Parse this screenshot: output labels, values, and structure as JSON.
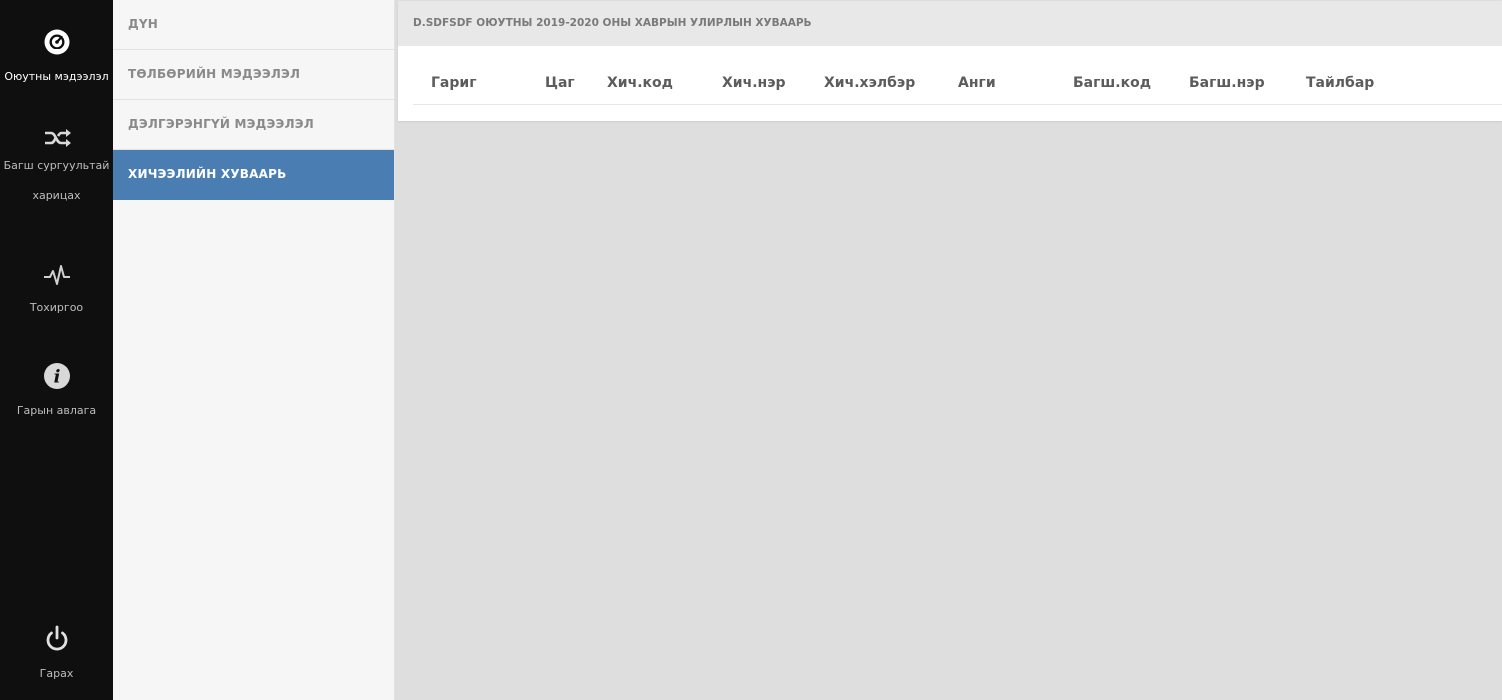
{
  "rail": {
    "items": [
      {
        "label": "Оюутны мэдээлэл",
        "icon": "dashboard-icon",
        "active": true
      },
      {
        "label": "Багш сургуультай",
        "label2": "харицах",
        "icon": "shuffle-icon"
      },
      {
        "label": "Тохиргоо",
        "icon": "pulse-icon"
      },
      {
        "label": "Гарын авлага",
        "icon": "info-icon"
      },
      {
        "label": "Гарах",
        "icon": "power-icon"
      }
    ]
  },
  "submenu": {
    "items": [
      {
        "label": "ДҮН"
      },
      {
        "label": "ТӨЛБӨРИЙН МЭДЭЭЛЭЛ"
      },
      {
        "label": "ДЭЛГЭРЭНГҮЙ МЭДЭЭЛЭЛ"
      },
      {
        "label": "ХИЧЭЭЛИЙН ХУВААРЬ",
        "active": true
      }
    ]
  },
  "panel": {
    "title": "D.SDFSDF ОЮУТНЫ 2019-2020 ОНЫ ХАВРЫН УЛИРЛЫН ХУВААРЬ"
  },
  "table": {
    "columns": [
      "Гариг",
      "Цаг",
      "Хич.код",
      "Хич.нэр",
      "Хич.хэлбэр",
      "Анги",
      "Багш.код",
      "Багш.нэр",
      "Тайлбар"
    ],
    "rows": []
  },
  "colors": {
    "rail_bg": "#0f0f0f",
    "active_menu": "#4a7db1",
    "content_bg": "#dedede"
  }
}
